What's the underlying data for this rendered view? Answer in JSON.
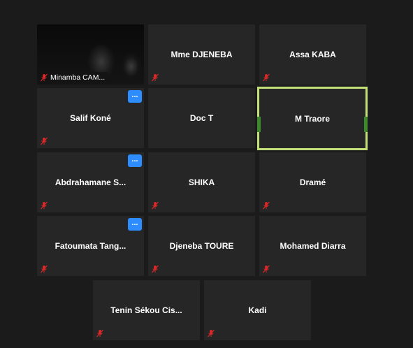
{
  "participants": [
    {
      "name": "Minamba CAM...",
      "muted": true,
      "video": true
    },
    {
      "name": "Mme DJENEBA",
      "muted": true
    },
    {
      "name": "Assa KABA",
      "muted": true
    },
    {
      "name": "Salif Koné",
      "muted": true,
      "menu": "..."
    },
    {
      "name": "Doc T"
    },
    {
      "name": "M Traore",
      "active": true
    },
    {
      "name": "Abdrahamane S...",
      "muted": true,
      "menu": "..."
    },
    {
      "name": "SHIKA",
      "muted": true
    },
    {
      "name": "Dramé",
      "muted": true
    },
    {
      "name": "Fatoumata Tang...",
      "muted": true,
      "menu": "..."
    },
    {
      "name": "Djeneba TOURE",
      "muted": true
    },
    {
      "name": "Mohamed Diarra",
      "muted": true
    },
    {
      "name": "Tenin Sékou Cis...",
      "muted": true
    },
    {
      "name": "Kadi",
      "muted": true
    }
  ],
  "colors": {
    "active_border": "#c3e07a",
    "menu_button": "#2d8cff",
    "muted_icon": "#e02828"
  }
}
